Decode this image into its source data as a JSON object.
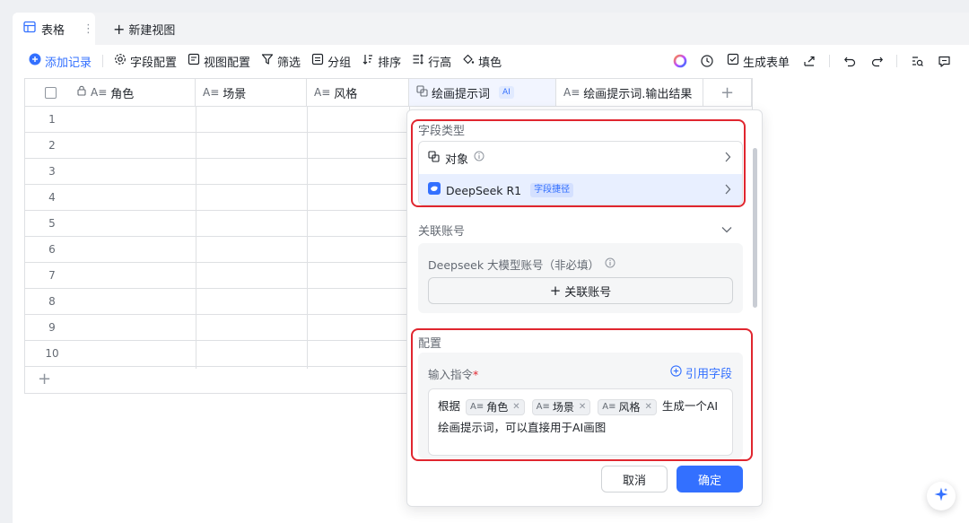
{
  "tabs": {
    "active": "表格",
    "new_view": "新建视图"
  },
  "toolbar": {
    "add_record": "添加记录",
    "field_config": "字段配置",
    "view_config": "视图配置",
    "filter": "筛选",
    "group": "分组",
    "sort": "排序",
    "row_height": "行高",
    "fill_color": "填色",
    "generate_form": "生成表单"
  },
  "grid": {
    "columns": [
      "角色",
      "场景",
      "风格",
      "绘画提示词",
      "绘画提示词.输出结果"
    ],
    "ai_tag": "AI",
    "rows": [
      "1",
      "2",
      "3",
      "4",
      "5",
      "6",
      "7",
      "8",
      "9",
      "10"
    ]
  },
  "panel": {
    "field_type_title": "字段类型",
    "option_object": "对象",
    "option_ai": "DeepSeek R1",
    "option_ai_tag": "字段捷径",
    "account_title": "关联账号",
    "account_hint": "Deepseek 大模型账号（非必填）",
    "account_button": "关联账号",
    "config_title": "配置",
    "input_label": "输入指令",
    "required_mark": "*",
    "ref_field": "引用字段",
    "prompt_prefix": "根据",
    "chips": [
      "角色",
      "场景",
      "风格"
    ],
    "prompt_suffix": "生成一个AI绘画提示词，可以直接用于AI画图",
    "cancel": "取消",
    "confirm": "确定"
  },
  "colors": {
    "accent": "#3370ff",
    "highlight": "#e0262f"
  }
}
